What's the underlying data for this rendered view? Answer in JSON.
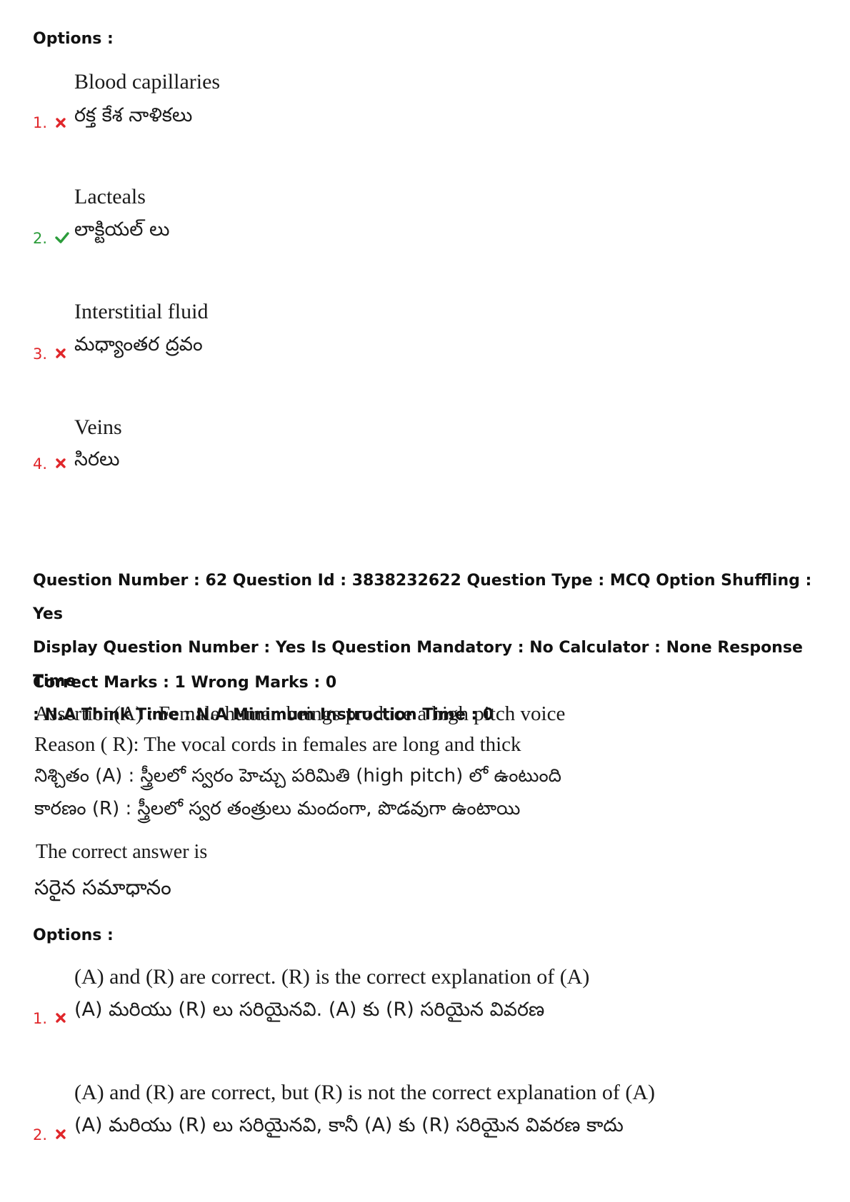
{
  "prev_question": {
    "options_label": "Options :",
    "options": [
      {
        "number": "1.",
        "status": "wrong",
        "status_icon": "cross-icon",
        "english": "Blood capillaries",
        "telugu": "రక్త కేశ నాళికలు"
      },
      {
        "number": "2.",
        "status": "correct",
        "status_icon": "check-icon",
        "english": "Lacteals",
        "telugu": "లాక్టియల్ లు"
      },
      {
        "number": "3.",
        "status": "wrong",
        "status_icon": "cross-icon",
        "english": "Interstitial fluid",
        "telugu": "మధ్యాంతర ద్రవం"
      },
      {
        "number": "4.",
        "status": "wrong",
        "status_icon": "cross-icon",
        "english": "Veins",
        "telugu": "సిరలు"
      }
    ]
  },
  "question": {
    "meta_line_1": "Question Number : 62 Question Id : 3838232622 Question Type : MCQ Option Shuffling : Yes",
    "meta_line_2": "Display Question Number : Yes Is Question Mandatory : No Calculator : None Response Time",
    "meta_line_3": ": N.A Think Time : N.A Minimum Instruction Time : 0",
    "marks": "Correct Marks : 1 Wrong Marks : 0",
    "assertion_en": "Assertion(A) : Female human beings produce a high pitch voice",
    "reason_en": "Reason ( R): The vocal cords in females are long and thick",
    "assertion_te": "నిశ్చితం (A) : స్త్రీలలో స్వరం హెచ్చు పరిమితి (high pitch) లో ఉంటుంది",
    "reason_te": "కారణం (R) : స్త్రీలలో స్వర తంత్రులు మందంగా, పొడవుగా ఉంటాయి",
    "prompt_en": "The correct answer is",
    "prompt_te": "సరైన సమాధానం",
    "options_label": "Options :",
    "options": [
      {
        "number": "1.",
        "status": "wrong",
        "status_icon": "cross-icon",
        "english": "(A) and (R) are correct. (R) is the correct explanation of (A)",
        "telugu": "(A) మరియు (R) లు సరియైనవి. (A) కు (R) సరియైన వివరణ"
      },
      {
        "number": "2.",
        "status": "wrong",
        "status_icon": "cross-icon",
        "english": "(A) and (R) are correct, but (R) is not the correct explanation of (A)",
        "telugu": "(A) మరియు (R) లు సరియైనవి, కానీ (A) కు (R) సరియైన వివరణ కాదు"
      }
    ]
  },
  "colors": {
    "wrong": "#e0262a",
    "correct": "#2b9c3a"
  }
}
